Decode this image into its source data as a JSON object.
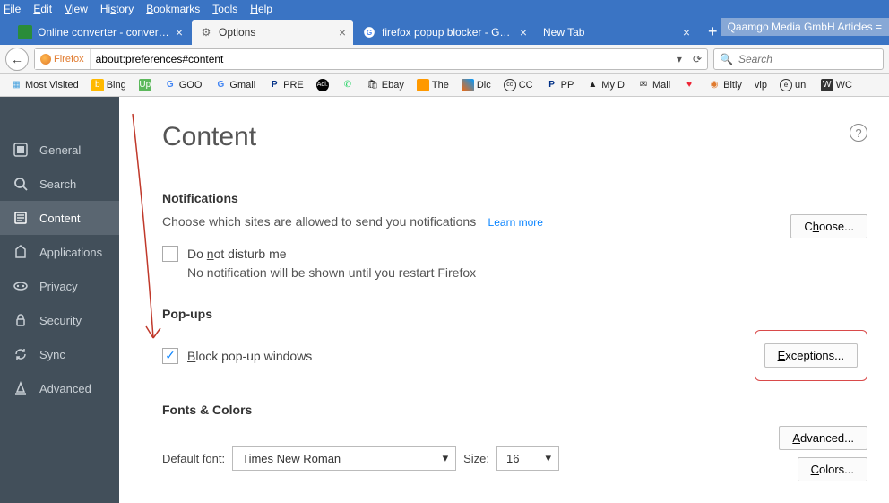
{
  "menu": [
    "File",
    "Edit",
    "View",
    "History",
    "Bookmarks",
    "Tools",
    "Help"
  ],
  "tabs": [
    {
      "label": "Online converter - convert ...",
      "active": false
    },
    {
      "label": "Options",
      "active": true
    },
    {
      "label": "firefox popup blocker - Goo...",
      "active": false
    },
    {
      "label": "New Tab",
      "active": false
    }
  ],
  "notif_banner": "Qaamgo Media GmbH Articles =",
  "urlbar": {
    "brand": "Firefox",
    "url": "about:preferences#content",
    "search_placeholder": "Search"
  },
  "bookmarks": [
    {
      "label": "Most Visited"
    },
    {
      "label": "Bing"
    },
    {
      "label": ""
    },
    {
      "label": "GOO"
    },
    {
      "label": "Gmail"
    },
    {
      "label": "PRE"
    },
    {
      "label": ""
    },
    {
      "label": ""
    },
    {
      "label": "Ebay"
    },
    {
      "label": "The"
    },
    {
      "label": "Dic"
    },
    {
      "label": "CC"
    },
    {
      "label": "PP"
    },
    {
      "label": "My D"
    },
    {
      "label": "Mail"
    },
    {
      "label": ""
    },
    {
      "label": "Bitly"
    },
    {
      "label": "vip"
    },
    {
      "label": "uni"
    },
    {
      "label": "WC"
    }
  ],
  "sidebar": {
    "items": [
      {
        "label": "General"
      },
      {
        "label": "Search"
      },
      {
        "label": "Content"
      },
      {
        "label": "Applications"
      },
      {
        "label": "Privacy"
      },
      {
        "label": "Security"
      },
      {
        "label": "Sync"
      },
      {
        "label": "Advanced"
      }
    ],
    "active_index": 2
  },
  "page": {
    "title": "Content",
    "notifications": {
      "heading": "Notifications",
      "desc": "Choose which sites are allowed to send you notifications",
      "learn": "Learn more",
      "choose_btn": "Choose...",
      "dnd_label": "Do not disturb me",
      "dnd_checked": false,
      "dnd_hint": "No notification will be shown until you restart Firefox"
    },
    "popups": {
      "heading": "Pop-ups",
      "block_label": "Block pop-up windows",
      "block_checked": true,
      "exceptions_btn": "Exceptions..."
    },
    "fonts": {
      "heading": "Fonts & Colors",
      "default_font_label": "Default font:",
      "default_font_value": "Times New Roman",
      "size_label": "Size:",
      "size_value": "16",
      "advanced_btn": "Advanced...",
      "colors_btn": "Colors..."
    }
  }
}
